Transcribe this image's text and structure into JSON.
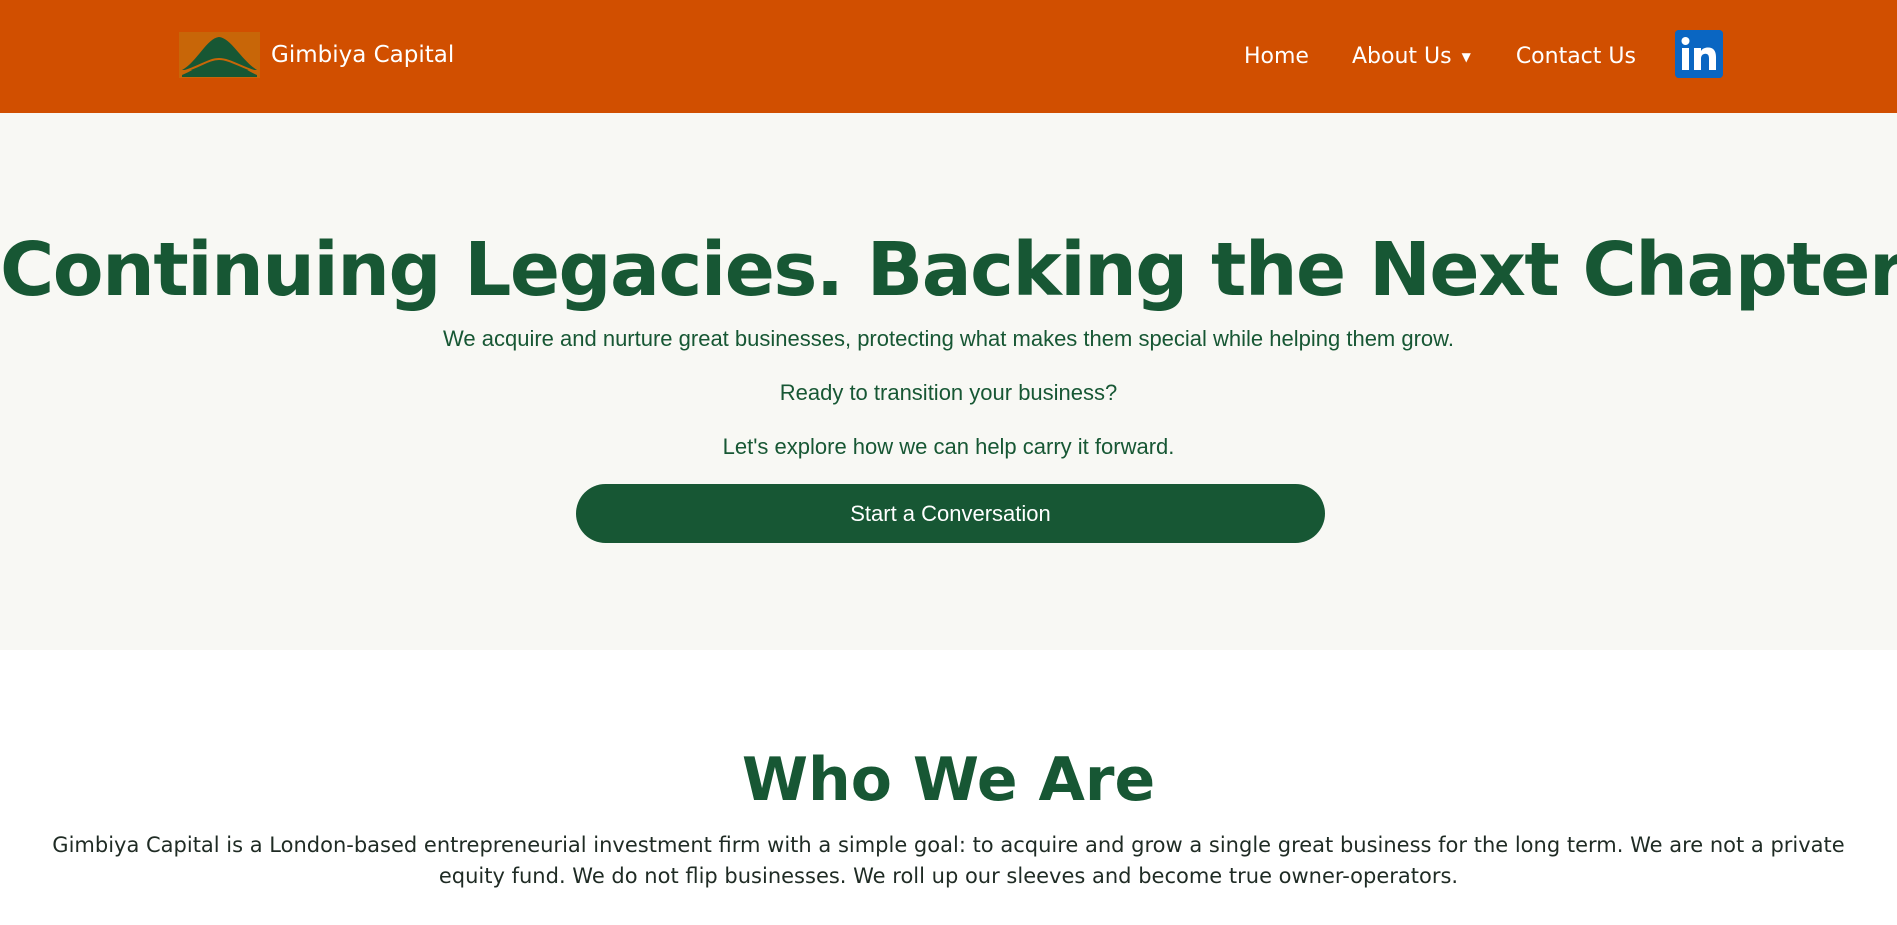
{
  "header": {
    "brand_name": "Gimbiya Capital",
    "nav": {
      "home": "Home",
      "about": "About Us",
      "contact": "Contact Us"
    },
    "social_icon": "linkedin-icon"
  },
  "hero": {
    "title": "Continuing Legacies. Backing the Next Chapter.",
    "tagline": "We acquire and nurture great businesses, protecting what makes them special while helping them grow.",
    "ready": "Ready to transition your business?",
    "explore": "Let's explore how we can help carry it forward.",
    "cta_label": "Start a Conversation"
  },
  "about": {
    "title": "Who We Are",
    "text": "Gimbiya Capital is a London-based entrepreneurial investment firm with a simple goal: to acquire and grow a single great business for the long term. We are not a private equity fund. We do not flip businesses. We roll up our sleeves and become true owner-operators."
  },
  "colors": {
    "header_bg": "#d14f00",
    "brand_green": "#175734",
    "hero_bg": "#f8f8f4",
    "linkedin_blue": "#0a66c2"
  }
}
